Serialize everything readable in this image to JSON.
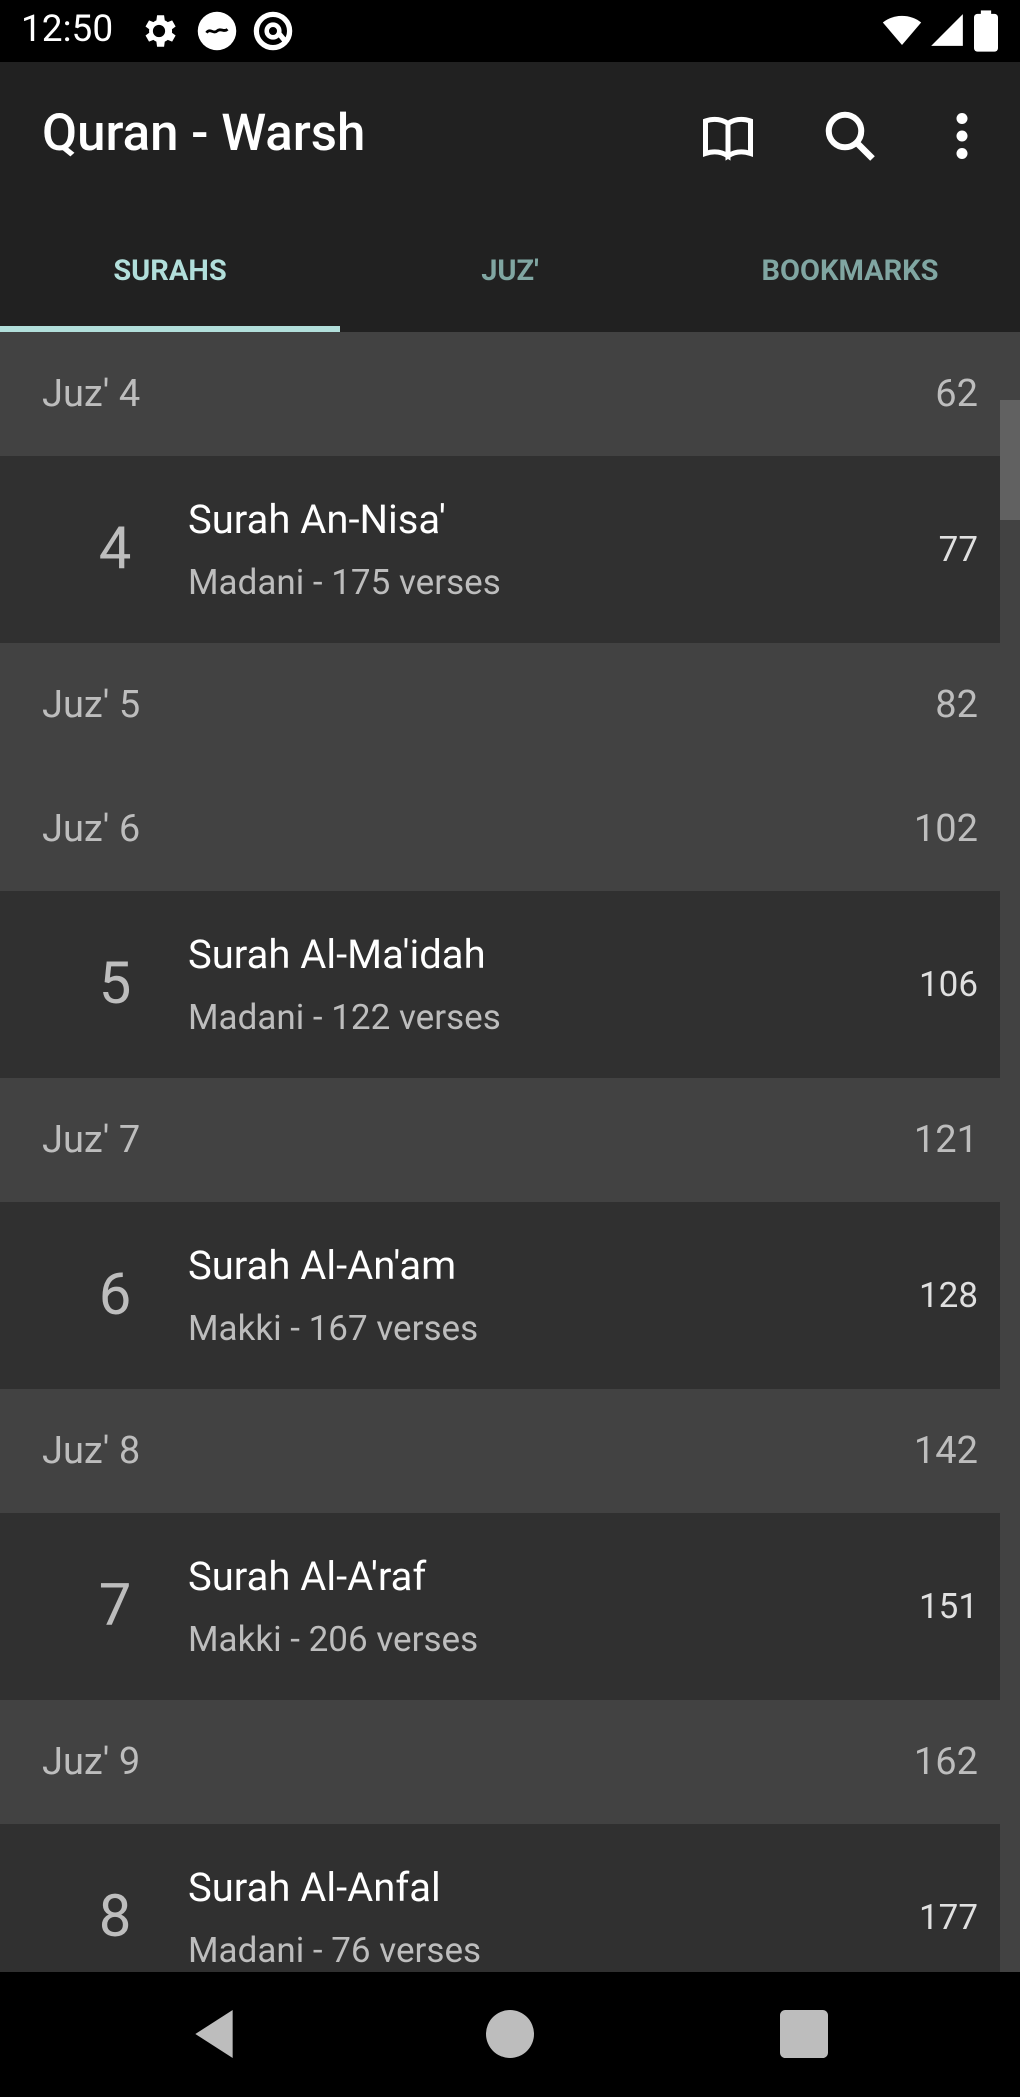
{
  "status_bar": {
    "time": "12:50"
  },
  "app_bar": {
    "title": "Quran - Warsh"
  },
  "tabs": [
    {
      "label": "SURAHS",
      "color": "#b2dfdb"
    },
    {
      "label": "JUZ'",
      "color": "#80a6a2"
    },
    {
      "label": "BOOKMARKS",
      "color": "#80a6a2"
    }
  ],
  "list": {
    "rows": [
      {
        "type": "juz",
        "label": "Juz' 4",
        "page": "62"
      },
      {
        "type": "surah",
        "number": "4",
        "name": "Surah An-Nisa'",
        "meta": "Madani - 175 verses",
        "page": "77"
      },
      {
        "type": "juz",
        "label": "Juz' 5",
        "page": "82"
      },
      {
        "type": "juz",
        "label": "Juz' 6",
        "page": "102"
      },
      {
        "type": "surah",
        "number": "5",
        "name": "Surah Al-Ma'idah",
        "meta": "Madani - 122 verses",
        "page": "106"
      },
      {
        "type": "juz",
        "label": "Juz' 7",
        "page": "121"
      },
      {
        "type": "surah",
        "number": "6",
        "name": "Surah Al-An'am",
        "meta": "Makki - 167 verses",
        "page": "128"
      },
      {
        "type": "juz",
        "label": "Juz' 8",
        "page": "142"
      },
      {
        "type": "surah",
        "number": "7",
        "name": "Surah Al-A'raf",
        "meta": "Makki - 206 verses",
        "page": "151"
      },
      {
        "type": "juz",
        "label": "Juz' 9",
        "page": "162"
      },
      {
        "type": "surah",
        "number": "8",
        "name": "Surah Al-Anfal",
        "meta": "Madani - 76 verses",
        "page": "177"
      }
    ]
  },
  "colors": {
    "accent": "#b2dfdb",
    "app_bar": "#212121",
    "juz_row": "#424242",
    "surah_row": "#303030"
  }
}
